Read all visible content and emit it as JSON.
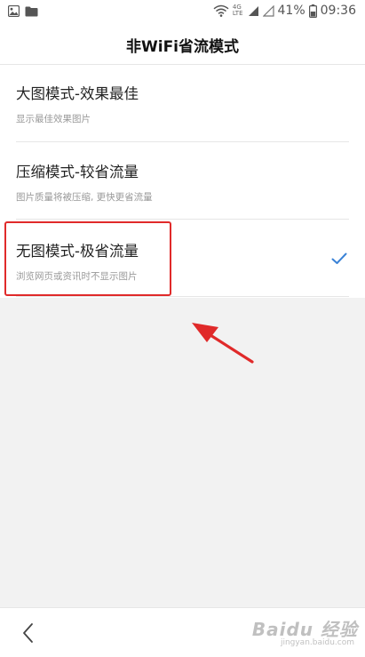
{
  "status_bar": {
    "network_top": "4G",
    "network_bottom": "LTE",
    "battery": "41%",
    "time": "09:36"
  },
  "header": {
    "title": "非WiFi省流模式"
  },
  "options": [
    {
      "title": "大图模式-效果最佳",
      "desc": "显示最佳效果图片",
      "selected": false
    },
    {
      "title": "压缩模式-较省流量",
      "desc": "图片质量将被压缩, 更快更省流量",
      "selected": false
    },
    {
      "title": "无图模式-极省流量",
      "desc": "浏览网页或资讯时不显示图片",
      "selected": true
    }
  ],
  "colors": {
    "accent": "#3a82d6",
    "annotation": "#e02a2a"
  },
  "watermark": {
    "logo": "Baidu 经验",
    "url": "jingyan.baidu.com"
  }
}
